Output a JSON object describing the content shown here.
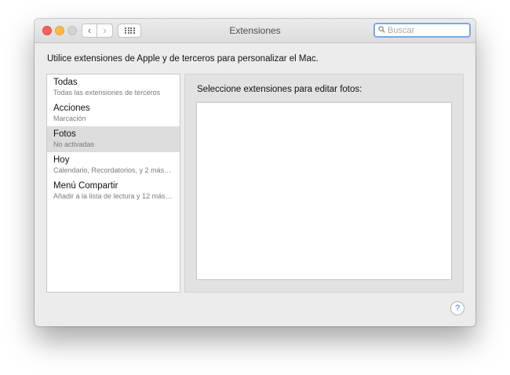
{
  "window": {
    "title": "Extensiones",
    "nav_back_icon": "‹",
    "nav_forward_icon": "›"
  },
  "search": {
    "placeholder": "Buscar",
    "value": ""
  },
  "intro_text": "Utilice extensiones de Apple y de terceros para personalizar el Mac.",
  "sidebar": {
    "items": [
      {
        "title": "Todas",
        "subtitle": "Todas las extensiones de terceros"
      },
      {
        "title": "Acciones",
        "subtitle": "Marcación"
      },
      {
        "title": "Fotos",
        "subtitle": "No activadas"
      },
      {
        "title": "Hoy",
        "subtitle": "Calendario, Recordatorios, y 2 más…"
      },
      {
        "title": "Menú Compartir",
        "subtitle": "Añadir a la lista de lectura y 12 más…"
      }
    ]
  },
  "content": {
    "label": "Seleccione extensiones para editar fotos:"
  },
  "help_label": "?",
  "colors": {
    "close": "#fc605b",
    "minimize": "#fdbc40",
    "zoom_disabled": "#d3d3d3",
    "search_focus": "#7aa7e8",
    "selection": "#dcdcdc"
  }
}
